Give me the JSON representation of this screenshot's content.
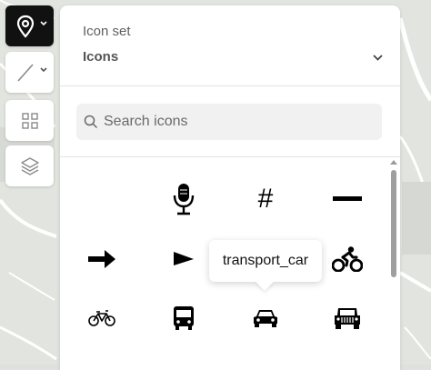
{
  "toolbar": {
    "items": [
      {
        "icon": "map-pin-icon",
        "active": true
      },
      {
        "icon": "line-icon",
        "active": false
      },
      {
        "icon": "grid-icon",
        "active": false
      },
      {
        "icon": "layers-icon",
        "active": false
      }
    ]
  },
  "panel": {
    "iconset_label": "Icon set",
    "iconset_value": "Icons",
    "search_placeholder": "Search icons",
    "search_value": "",
    "icons": [
      {
        "name": "blank",
        "glyph": ""
      },
      {
        "name": "microphone-icon",
        "glyph": ""
      },
      {
        "name": "hashtag-icon",
        "glyph": "#"
      },
      {
        "name": "minus-icon",
        "glyph": ""
      },
      {
        "name": "arrow-right-icon",
        "glyph": ""
      },
      {
        "name": "flag-icon",
        "glyph": ""
      },
      {
        "name": "transport-car-hidden",
        "glyph": ""
      },
      {
        "name": "cyclist-icon",
        "glyph": ""
      },
      {
        "name": "bicycle-icon",
        "glyph": ""
      },
      {
        "name": "bus-icon",
        "glyph": ""
      },
      {
        "name": "car-icon",
        "glyph": ""
      },
      {
        "name": "jeep-icon",
        "glyph": ""
      }
    ],
    "tooltip": "transport_car"
  },
  "colors": {
    "toolbar_active": "#111111",
    "panel_bg": "#ffffff",
    "search_bg": "#f1f1f1"
  }
}
